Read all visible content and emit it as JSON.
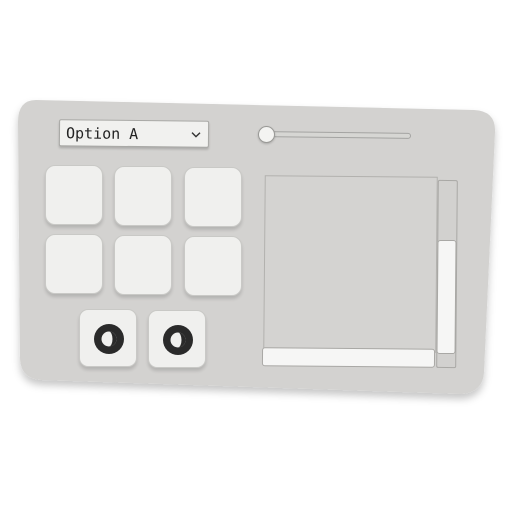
{
  "panel": {
    "background_color": "#d3d2d0",
    "accent_color": "#f0f0ee"
  },
  "dropdown": {
    "selected_value": "Option A",
    "icon": "chevron-down-icon"
  },
  "slider": {
    "value_fraction": 0.0
  },
  "pads": {
    "count": 6
  },
  "icon_buttons": [
    {
      "icon": "half-moon-dial-icon"
    },
    {
      "icon": "half-moon-dial-icon"
    }
  ],
  "scroll_area": {
    "vertical_thumb_position_fraction": 0.6,
    "horizontal_thumb_position_fraction": 0.0
  }
}
